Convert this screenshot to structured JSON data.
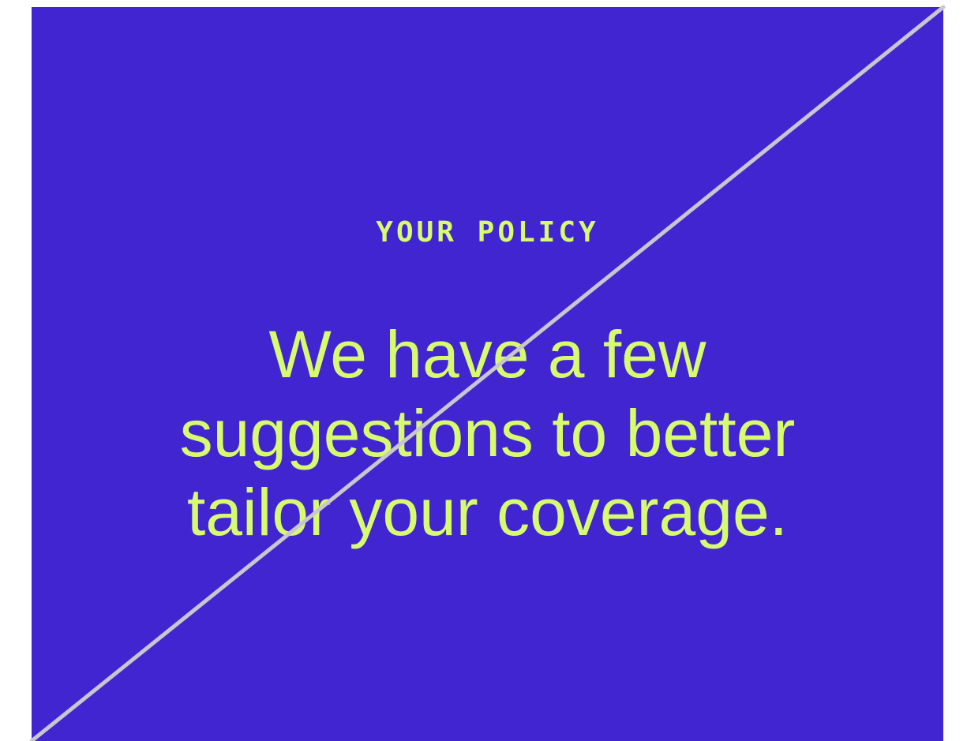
{
  "colors": {
    "background": "#4125d1",
    "text": "#d7fb6f",
    "slash": "#c9c6cf"
  },
  "eyebrow": "YOUR POLICY",
  "headline": {
    "lines": [
      "We have a few",
      "suggestions to better",
      "tailor your coverage."
    ]
  },
  "overlay": {
    "icon": "diagonal-slash"
  }
}
